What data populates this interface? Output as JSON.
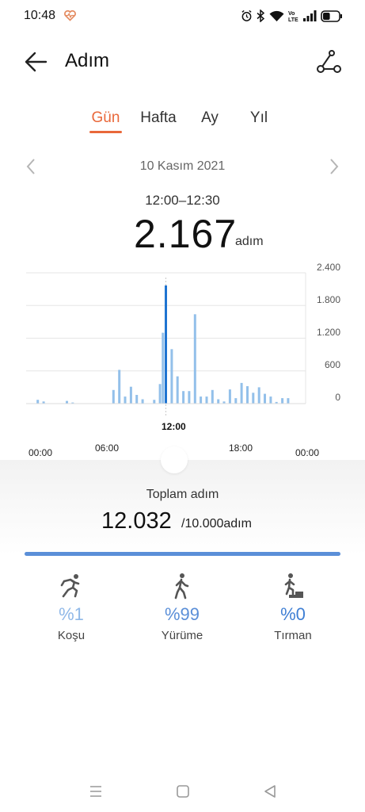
{
  "status_bar": {
    "time": "10:48",
    "icons": [
      "heart-rate-icon",
      "alarm-icon",
      "bluetooth-icon",
      "wifi-icon",
      "volte-icon",
      "signal-icon",
      "battery-icon"
    ],
    "volte_text": "Vo LTE",
    "battery_level": 0.45
  },
  "header": {
    "title": "Adım",
    "back_icon": "arrow-left-icon",
    "route_icon": "route-icon"
  },
  "tabs": [
    {
      "label": "Gün",
      "active": true
    },
    {
      "label": "Hafta",
      "active": false
    },
    {
      "label": "Ay",
      "active": false
    },
    {
      "label": "Yıl",
      "active": false
    }
  ],
  "date_nav": {
    "date": "10 Kasım 2021",
    "prev_icon": "chevron-left-icon",
    "next_icon": "chevron-right-icon"
  },
  "selection": {
    "time_range": "12:00–12:30",
    "steps": "2.167",
    "unit": "adım"
  },
  "chart_data": {
    "type": "bar",
    "x_unit": "hours",
    "xlim": [
      0,
      24
    ],
    "ylim": [
      0,
      2400
    ],
    "yticks": [
      "2.400",
      "1.800",
      "1.200",
      "600",
      "0"
    ],
    "ytick_values": [
      2400,
      1800,
      1200,
      600,
      0
    ],
    "xticks": [
      "00:00",
      "06:00",
      "18:00",
      "00:00"
    ],
    "selected_label": "12:00",
    "selected_x": 12.0,
    "x": [
      1.0,
      1.5,
      3.5,
      4.0,
      7.5,
      8.0,
      8.5,
      9.0,
      9.5,
      10.0,
      11.0,
      11.5,
      11.75,
      12.0,
      12.5,
      13.0,
      13.5,
      14.0,
      14.5,
      15.0,
      15.5,
      16.0,
      16.5,
      17.0,
      17.5,
      18.0,
      18.5,
      19.0,
      19.5,
      20.0,
      20.5,
      21.0,
      21.5,
      22.0,
      22.5
    ],
    "values": [
      70,
      40,
      50,
      20,
      250,
      620,
      130,
      310,
      160,
      80,
      70,
      360,
      1300,
      2167,
      1000,
      500,
      230,
      230,
      1640,
      130,
      130,
      250,
      80,
      40,
      260,
      100,
      380,
      320,
      200,
      300,
      180,
      130,
      30,
      100,
      100
    ],
    "colors": {
      "bar": "#93c0ea",
      "selected": "#1f74d1"
    }
  },
  "summary": {
    "label": "Toplam adım",
    "total": "12.032",
    "goal": "/10.000adım",
    "progress": 1.0
  },
  "activities": [
    {
      "icon": "running-icon",
      "percent": "%1",
      "label": "Koşu",
      "color": "#8fb8e8"
    },
    {
      "icon": "walking-icon",
      "percent": "%99",
      "label": "Yürüme",
      "color": "#5b8fd8"
    },
    {
      "icon": "climbing-icon",
      "percent": "%0",
      "label": "Tırman",
      "color": "#3f7fd4"
    }
  ],
  "nav": {
    "icons": [
      "menu-icon",
      "home-icon",
      "back-icon"
    ]
  }
}
